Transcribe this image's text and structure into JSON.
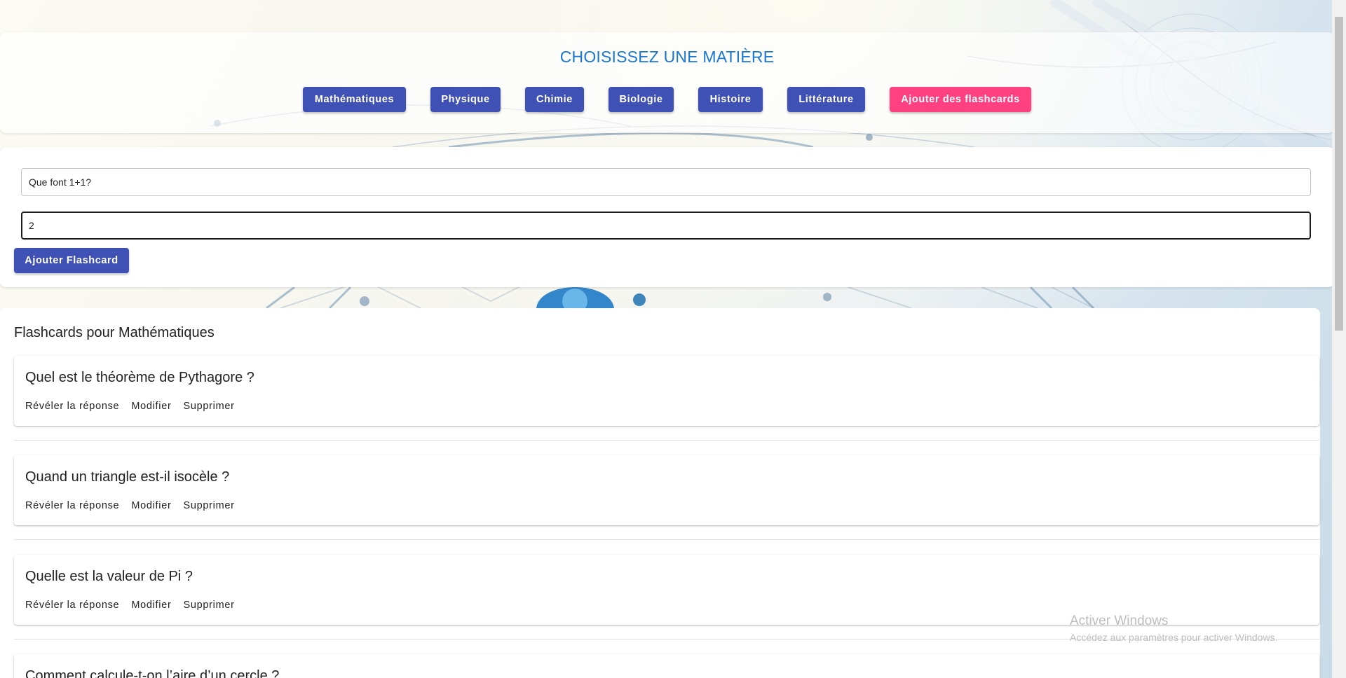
{
  "header": {
    "title": "CHOISISSEZ UNE MATIÈRE",
    "subjects": [
      "Mathématiques",
      "Physique",
      "Chimie",
      "Biologie",
      "Histoire",
      "Littérature"
    ],
    "add_button": "Ajouter des flashcards"
  },
  "form": {
    "question_value": "Que font 1+1?",
    "answer_value": "2",
    "submit_label": "Ajouter Flashcard"
  },
  "list": {
    "title": "Flashcards pour Mathématiques",
    "actions": {
      "reveal": "Révéler la réponse",
      "edit": "Modifier",
      "delete": "Supprimer"
    },
    "cards": [
      {
        "question": "Quel est le théorème de Pythagore ?"
      },
      {
        "question": "Quand un triangle est-il isocèle ?"
      },
      {
        "question": "Quelle est la valeur de Pi ?"
      },
      {
        "question": "Comment calcule-t-on l’aire d’un cercle ?"
      }
    ]
  },
  "watermark": {
    "line1": "Activer Windows",
    "line2": "Accédez aux paramètres pour activer Windows."
  },
  "colors": {
    "primary": "#3f51b5",
    "accent": "#ff4081",
    "title_blue": "#1976d2"
  }
}
